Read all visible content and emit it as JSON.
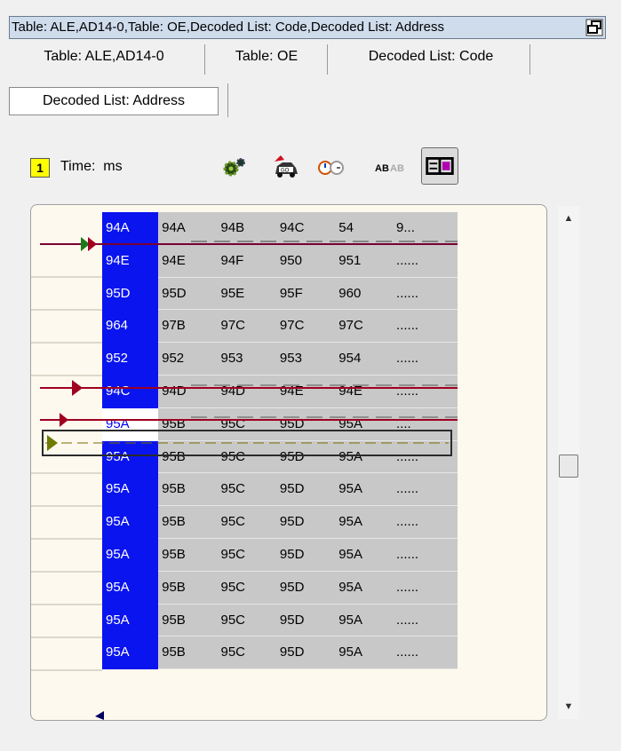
{
  "window": {
    "title": "Table: ALE,AD14-0,Table: OE,Decoded List: Code,Decoded List: Address",
    "restore_icon": "restore-window-icon"
  },
  "tabs": [
    {
      "label": "Table: ALE,AD14-0"
    },
    {
      "label": "Table: OE"
    },
    {
      "label": "Decoded List: Code"
    },
    {
      "label": "Decoded List: Address"
    }
  ],
  "toolbar": {
    "counter": "1",
    "time_label": "Time:",
    "time_unit": "ms",
    "icons": [
      "settings-gear-icon",
      "car-icon",
      "stopwatch-icon",
      "ab-font-icon",
      "view-mode-icon"
    ]
  },
  "rows": [
    {
      "addr": "94A",
      "c": [
        "94A",
        "94B",
        "94C",
        "54",
        "9..."
      ]
    },
    {
      "addr": "94E",
      "c": [
        "94E",
        "94F",
        "950",
        "951",
        "......"
      ]
    },
    {
      "addr": "95D",
      "c": [
        "95D",
        "95E",
        "95F",
        "960",
        "......"
      ]
    },
    {
      "addr": "964",
      "c": [
        "97B",
        "97C",
        "97C",
        "97C",
        "......"
      ]
    },
    {
      "addr": "952",
      "c": [
        "952",
        "953",
        "953",
        "954",
        "......"
      ]
    },
    {
      "addr": "94C",
      "c": [
        "94D",
        "94D",
        "94E",
        "94E",
        "......"
      ]
    },
    {
      "addr": "95A",
      "c": [
        "95B",
        "95C",
        "95D",
        "95A",
        "...."
      ]
    },
    {
      "addr": "95A",
      "c": [
        "95B",
        "95C",
        "95D",
        "95A",
        "......"
      ]
    },
    {
      "addr": "95A",
      "c": [
        "95B",
        "95C",
        "95D",
        "95A",
        "......"
      ]
    },
    {
      "addr": "95A",
      "c": [
        "95B",
        "95C",
        "95D",
        "95A",
        "......"
      ]
    },
    {
      "addr": "95A",
      "c": [
        "95B",
        "95C",
        "95D",
        "95A",
        "......"
      ]
    },
    {
      "addr": "95A",
      "c": [
        "95B",
        "95C",
        "95D",
        "95A",
        "......"
      ]
    },
    {
      "addr": "95A",
      "c": [
        "95B",
        "95C",
        "95D",
        "95A",
        "......"
      ]
    },
    {
      "addr": "95A",
      "c": [
        "95B",
        "95C",
        "95D",
        "95A",
        "......"
      ]
    }
  ],
  "selected_row": 6,
  "colors": {
    "address_column": "#0a14ee",
    "cell_bg": "#c8c8c8",
    "pane_bg": "#fdf9ee",
    "marker_red": "#a00020",
    "marker_green": "#1a7a1a",
    "counter_bg": "#ffff00"
  }
}
